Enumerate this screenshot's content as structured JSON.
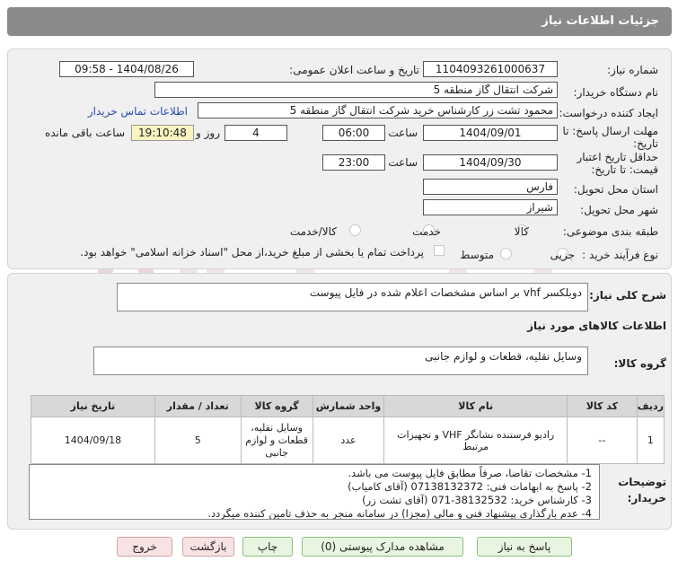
{
  "header": {
    "title": "جزئیات اطلاعات نیاز"
  },
  "fields": {
    "need_number_label": "شماره نیاز:",
    "need_number": "1104093261000637",
    "announce_label": "تاریخ و ساعت اعلان عمومی:",
    "announce_value": "1404/08/26 - 09:58",
    "buyer_org_label": "نام دستگاه خریدار:",
    "buyer_org": "شرکت انتقال گاز منطقه 5",
    "creator_label": "ایجاد کننده درخواست:",
    "creator": "محمود تشت زر کارشناس خرید شرکت انتقال گاز منطقه 5",
    "contact_link": "اطلاعات تماس خریدار",
    "deadline_label_1": "مهلت ارسال پاسخ: تا",
    "deadline_label_2": "تاریخ:",
    "deadline_date": "1404/09/01",
    "time_label": "ساعت",
    "deadline_time": "06:00",
    "days_value": "4",
    "days_label": "روز و",
    "remaining_time": "19:10:48",
    "remaining_label": "ساعت باقی مانده",
    "validity_label_1": "حداقل تاریخ اعتبار",
    "validity_label_2": "قیمت: تا تاریخ:",
    "validity_date": "1404/09/30",
    "validity_time": "23:00",
    "province_label": "استان محل تحویل:",
    "province": "فارس",
    "city_label": "شهر محل تحویل:",
    "city": "شیراز",
    "category_label": "طبقه بندی موضوعی:",
    "category_options": [
      "کالا",
      "خدمت",
      "کالا/خدمت"
    ],
    "process_label": "نوع فرآیند خرید :",
    "process_options": [
      "جزیی",
      "متوسط"
    ],
    "payment_note": "پرداخت تمام یا بخشی از مبلغ خرید،از محل \"اسناد خزانه اسلامی\" خواهد بود."
  },
  "summary": {
    "label": "شرح کلی نیاز:",
    "text": "دوبلکسر vhf بر اساس مشخصات اعلام شده در فایل پیوست"
  },
  "goods_info_title": "اطلاعات کالاهای مورد نیاز",
  "goods_group": {
    "label": "گروه کالا:",
    "value": "وسایل نقلیه، قطعات و لوازم جانبی"
  },
  "table": {
    "headers": [
      "ردیف",
      "کد کالا",
      "نام کالا",
      "واحد شمارش",
      "گروه کالا",
      "تعداد / مقدار",
      "تاریخ نیاز"
    ],
    "rows": [
      {
        "row": "1",
        "code": "--",
        "name": "رادیو فرستنده نشانگر VHF و تجهیزات مرتبط",
        "unit": "عدد",
        "group_1": "وسایل نقلیه،",
        "group_2": "قطعات و لوازم",
        "group_3": "جانبی",
        "qty": "5",
        "date": "1404/09/18"
      }
    ]
  },
  "notes": {
    "label_1": "توضیحات",
    "label_2": "خریدار:",
    "lines": [
      "1-  مشخصات تقاضا، صرفاً مطابق فایل پیوست می باشد.",
      "2- پاسخ به ابهامات فنی: 07138132372 (آقای کامیاب)",
      "3- کارشناس خرید: 38132532-071 (آقای تشت زر)",
      "4- عدم بارگذاری پیشنهاد فنی و مالی (مجزا) در سامانه منجر به حذف تامین کننده میگردد."
    ]
  },
  "buttons": {
    "reply": "پاسخ به نیاز",
    "attachments": "مشاهده مدارک پیوستی (0)",
    "print": "چاپ",
    "back": "بازگشت",
    "exit": "خروج"
  },
  "colors": {
    "header_bg": "#8a8a8a",
    "panel_bg": "#f0f0f0",
    "link": "#2a4db0",
    "timer_bg": "#f8f3c0",
    "watermark": "#e8d6d6"
  }
}
